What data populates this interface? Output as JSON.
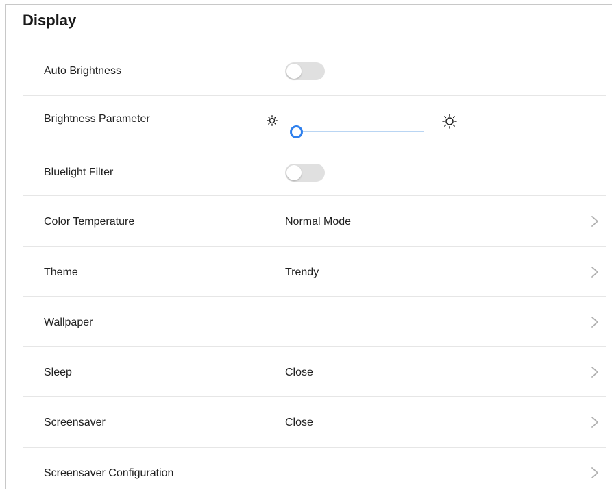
{
  "page": {
    "title": "Display"
  },
  "colors": {
    "accent": "#2f80ed",
    "track": "#b9d5f3",
    "toggle_off": "#e0e0e0",
    "divider": "#e6e6e6",
    "chevron": "#b0b0b0"
  },
  "settings": {
    "auto_brightness": {
      "label": "Auto Brightness",
      "enabled": false
    },
    "brightness": {
      "label": "Brightness Parameter",
      "value_fraction": 0.0,
      "low_icon": "sun-small-icon",
      "high_icon": "sun-large-icon"
    },
    "bluelight": {
      "label": "Bluelight Filter",
      "enabled": false
    },
    "color_temperature": {
      "label": "Color Temperature",
      "value": "Normal Mode"
    },
    "theme": {
      "label": "Theme",
      "value": "Trendy"
    },
    "wallpaper": {
      "label": "Wallpaper"
    },
    "sleep": {
      "label": "Sleep",
      "value": "Close"
    },
    "screensaver": {
      "label": "Screensaver",
      "value": "Close"
    },
    "screensaver_config": {
      "label": "Screensaver Configuration"
    }
  },
  "icons": {
    "chevron": "chevron-right-icon"
  }
}
